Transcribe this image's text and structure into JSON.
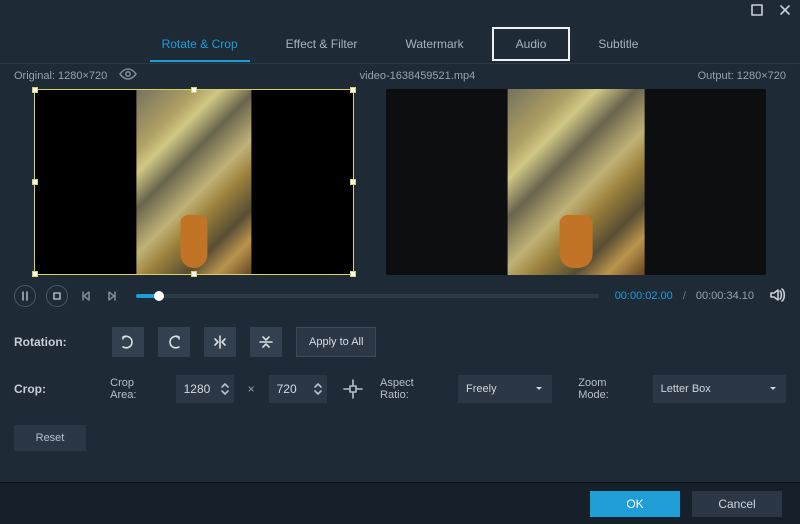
{
  "window": {
    "tabs": [
      {
        "label": "Rotate & Crop",
        "active": true,
        "boxed": false
      },
      {
        "label": "Effect & Filter",
        "active": false,
        "boxed": false
      },
      {
        "label": "Watermark",
        "active": false,
        "boxed": false
      },
      {
        "label": "Audio",
        "active": false,
        "boxed": true
      },
      {
        "label": "Subtitle",
        "active": false,
        "boxed": false
      }
    ]
  },
  "info": {
    "original_label": "Original: 1280×720",
    "filename": "video-1638459521.mp4",
    "output_label": "Output: 1280×720"
  },
  "playback": {
    "current": "00:00:02.00",
    "sep": "/",
    "duration": "00:00:34.10",
    "progress_pct": 5
  },
  "rotation": {
    "label": "Rotation:",
    "apply_all": "Apply to All"
  },
  "crop": {
    "label": "Crop:",
    "area_label": "Crop Area:",
    "width": "1280",
    "height": "720",
    "mult": "×",
    "aspect_label": "Aspect Ratio:",
    "aspect_value": "Freely",
    "zoom_label": "Zoom Mode:",
    "zoom_value": "Letter Box",
    "reset": "Reset"
  },
  "footer": {
    "ok": "OK",
    "cancel": "Cancel"
  }
}
